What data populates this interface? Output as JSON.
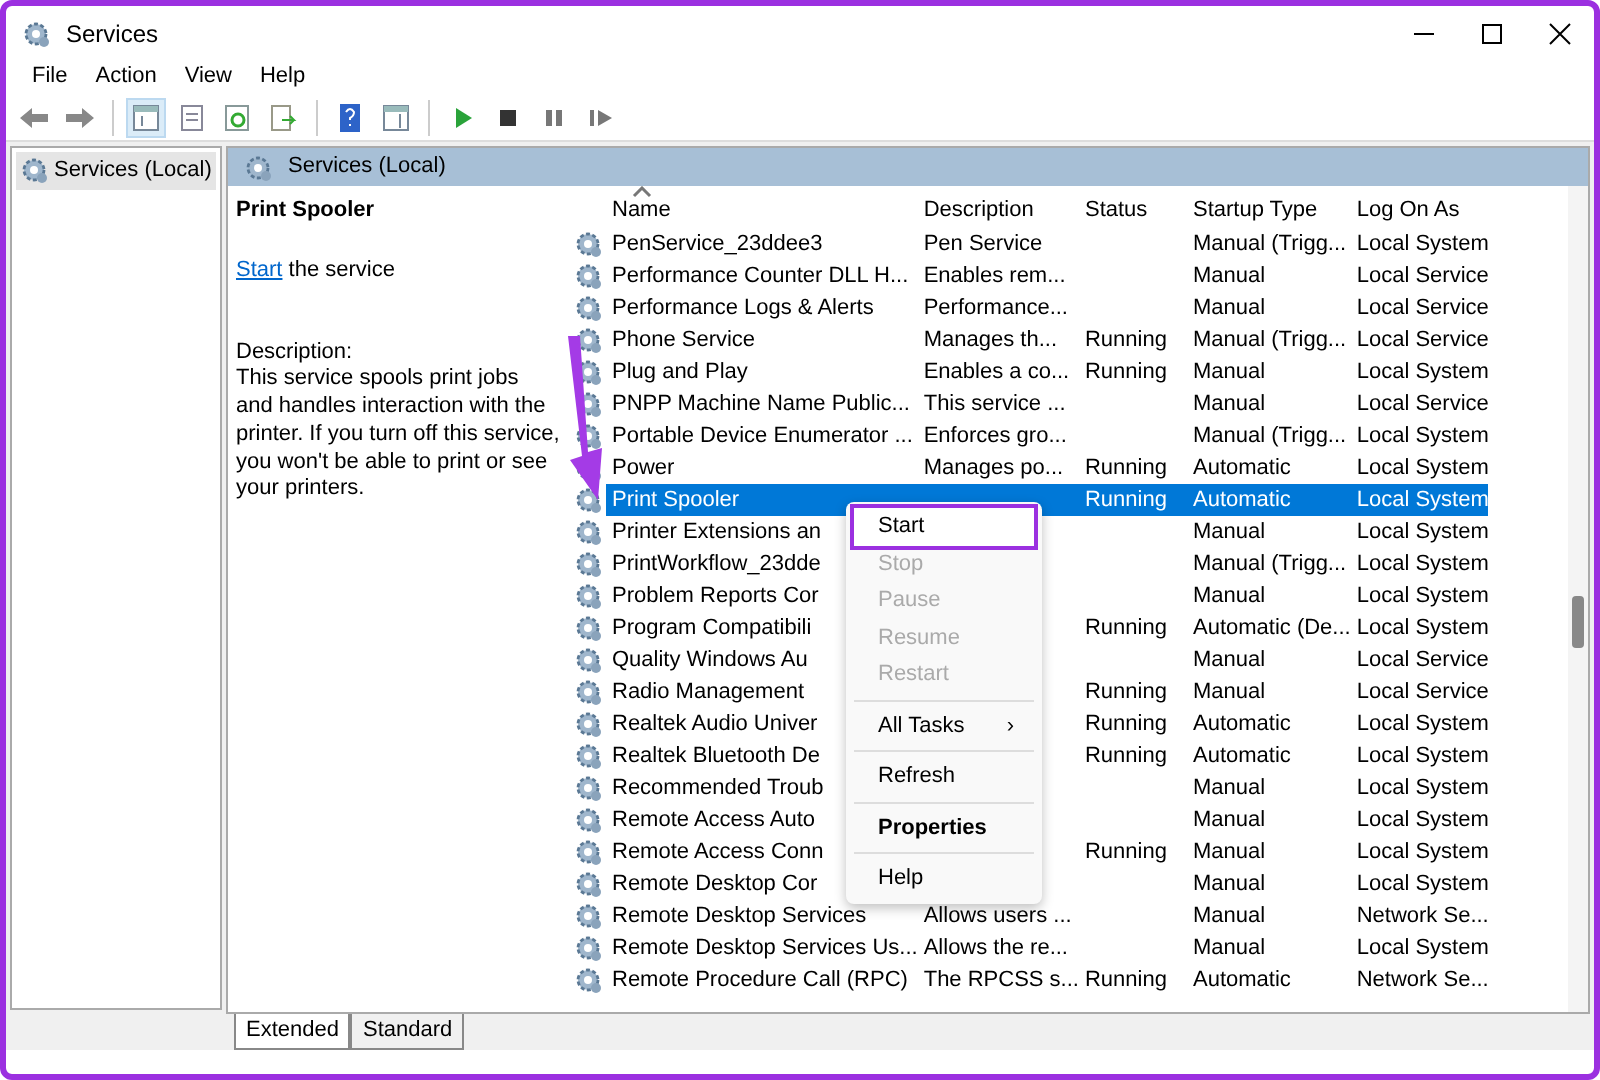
{
  "window": {
    "title": "Services"
  },
  "menu_bar": [
    "File",
    "Action",
    "View",
    "Help"
  ],
  "toolbar": [
    {
      "kind": "back",
      "selected": false
    },
    {
      "kind": "forward",
      "selected": false
    },
    {
      "kind": "sep"
    },
    {
      "kind": "tree",
      "selected": true
    },
    {
      "kind": "props",
      "selected": false
    },
    {
      "kind": "refresh",
      "selected": false
    },
    {
      "kind": "export",
      "selected": false
    },
    {
      "kind": "sep"
    },
    {
      "kind": "help",
      "selected": false
    },
    {
      "kind": "pane",
      "selected": false
    },
    {
      "kind": "sep"
    },
    {
      "kind": "play",
      "selected": false
    },
    {
      "kind": "stop",
      "selected": false
    },
    {
      "kind": "pause",
      "selected": false
    },
    {
      "kind": "resume",
      "selected": false
    }
  ],
  "tree": [
    {
      "label": "Services (Local)",
      "selected": true
    }
  ],
  "panel": {
    "title": "Services (Local)"
  },
  "detail": {
    "title": "Print Spooler",
    "link": "Start",
    "link_rest": " the service",
    "description_label": "Description:",
    "description": "This service spools print jobs and handles interaction with the printer. If you turn off this service, you won't be able to print or see your printers."
  },
  "table": {
    "columns": [
      {
        "label": "Name",
        "sorted": true
      },
      {
        "label": "Description",
        "sorted": false
      },
      {
        "label": "Status",
        "sorted": false
      },
      {
        "label": "Startup Type",
        "sorted": false
      },
      {
        "label": "Log On As",
        "sorted": false
      }
    ],
    "rows": [
      {
        "name": "PenService_23ddee3",
        "description": "Pen Service",
        "startup_type": "Manual (Trigg...",
        "log_on_as": "Local System",
        "selected": false
      },
      {
        "name": "Performance Counter DLL H...",
        "description": "Enables rem...",
        "startup_type": "Manual",
        "log_on_as": "Local Service",
        "selected": false
      },
      {
        "name": "Performance Logs & Alerts",
        "description": "Performance...",
        "startup_type": "Manual",
        "log_on_as": "Local Service",
        "selected": false
      },
      {
        "name": "Phone Service",
        "description": "Manages th...",
        "status": "Running",
        "startup_type": "Manual (Trigg...",
        "log_on_as": "Local Service",
        "selected": false
      },
      {
        "name": "Plug and Play",
        "description": "Enables a co...",
        "status": "Running",
        "startup_type": "Manual",
        "log_on_as": "Local System",
        "selected": false
      },
      {
        "name": "PNPP Machine Name Public...",
        "description": "This service ...",
        "startup_type": "Manual",
        "log_on_as": "Local Service",
        "selected": false
      },
      {
        "name": "Portable Device Enumerator ...",
        "description": "Enforces gro...",
        "startup_type": "Manual (Trigg...",
        "log_on_as": "Local System",
        "selected": false
      },
      {
        "name": "Power",
        "description": "Manages po...",
        "status": "Running",
        "startup_type": "Automatic",
        "log_on_as": "Local System",
        "selected": false
      },
      {
        "name": "Print Spooler",
        "status": "Running",
        "startup_type": "Automatic",
        "log_on_as": "Local System",
        "selected": true
      },
      {
        "name": "Printer Extensions an",
        "startup_type": "Manual",
        "log_on_as": "Local System",
        "selected": false
      },
      {
        "name": "PrintWorkflow_23dde",
        "startup_type": "Manual (Trigg...",
        "log_on_as": "Local System",
        "selected": false
      },
      {
        "name": "Problem Reports Cor",
        "startup_type": "Manual",
        "log_on_as": "Local System",
        "selected": false
      },
      {
        "name": "Program Compatibili",
        "status": "Running",
        "startup_type": "Automatic (De...",
        "log_on_as": "Local System",
        "selected": false
      },
      {
        "name": "Quality Windows Au",
        "startup_type": "Manual",
        "log_on_as": "Local Service",
        "selected": false
      },
      {
        "name": "Radio Management",
        "status": "Running",
        "startup_type": "Manual",
        "log_on_as": "Local Service",
        "selected": false
      },
      {
        "name": "Realtek Audio Univer",
        "status": "Running",
        "startup_type": "Automatic",
        "log_on_as": "Local System",
        "selected": false
      },
      {
        "name": "Realtek Bluetooth De",
        "status": "Running",
        "startup_type": "Automatic",
        "log_on_as": "Local System",
        "selected": false
      },
      {
        "name": "Recommended Troub",
        "startup_type": "Manual",
        "log_on_as": "Local System",
        "selected": false
      },
      {
        "name": "Remote Access Auto",
        "startup_type": "Manual",
        "log_on_as": "Local System",
        "selected": false
      },
      {
        "name": "Remote Access Conn",
        "status": "Running",
        "startup_type": "Manual",
        "log_on_as": "Local System",
        "selected": false
      },
      {
        "name": "Remote Desktop Cor",
        "startup_type": "Manual",
        "log_on_as": "Local System",
        "selected": false
      },
      {
        "name": "Remote Desktop Services",
        "description": "Allows users ...",
        "startup_type": "Manual",
        "log_on_as": "Network Se...",
        "selected": false
      },
      {
        "name": "Remote Desktop Services Us...",
        "description": "Allows the re...",
        "startup_type": "Manual",
        "log_on_as": "Local System",
        "selected": false
      },
      {
        "name": "Remote Procedure Call (RPC)",
        "description": "The RPCSS s...",
        "status": "Running",
        "startup_type": "Automatic",
        "log_on_as": "Network Se...",
        "selected": false
      }
    ]
  },
  "context_menu": [
    {
      "kind": "item",
      "label": "Start",
      "disabled": false,
      "highlighted": true
    },
    {
      "kind": "item",
      "label": "Stop",
      "disabled": true,
      "highlighted": false
    },
    {
      "kind": "item",
      "label": "Pause",
      "disabled": true,
      "highlighted": false
    },
    {
      "kind": "item",
      "label": "Resume",
      "disabled": true,
      "highlighted": false
    },
    {
      "kind": "item",
      "label": "Restart",
      "disabled": true,
      "highlighted": false
    },
    {
      "kind": "separator"
    },
    {
      "kind": "submenu",
      "label": "All Tasks",
      "arrow": "›",
      "disabled": false,
      "highlighted": false
    },
    {
      "kind": "separator"
    },
    {
      "kind": "item",
      "label": "Refresh",
      "disabled": false,
      "highlighted": false
    },
    {
      "kind": "separator"
    },
    {
      "kind": "default",
      "label": "Properties",
      "disabled": false,
      "highlighted": false
    },
    {
      "kind": "separator"
    },
    {
      "kind": "item",
      "label": "Help",
      "disabled": false,
      "highlighted": false
    }
  ],
  "tabs": [
    {
      "label": "Extended",
      "selected": true
    },
    {
      "label": "Standard",
      "selected": false
    }
  ]
}
